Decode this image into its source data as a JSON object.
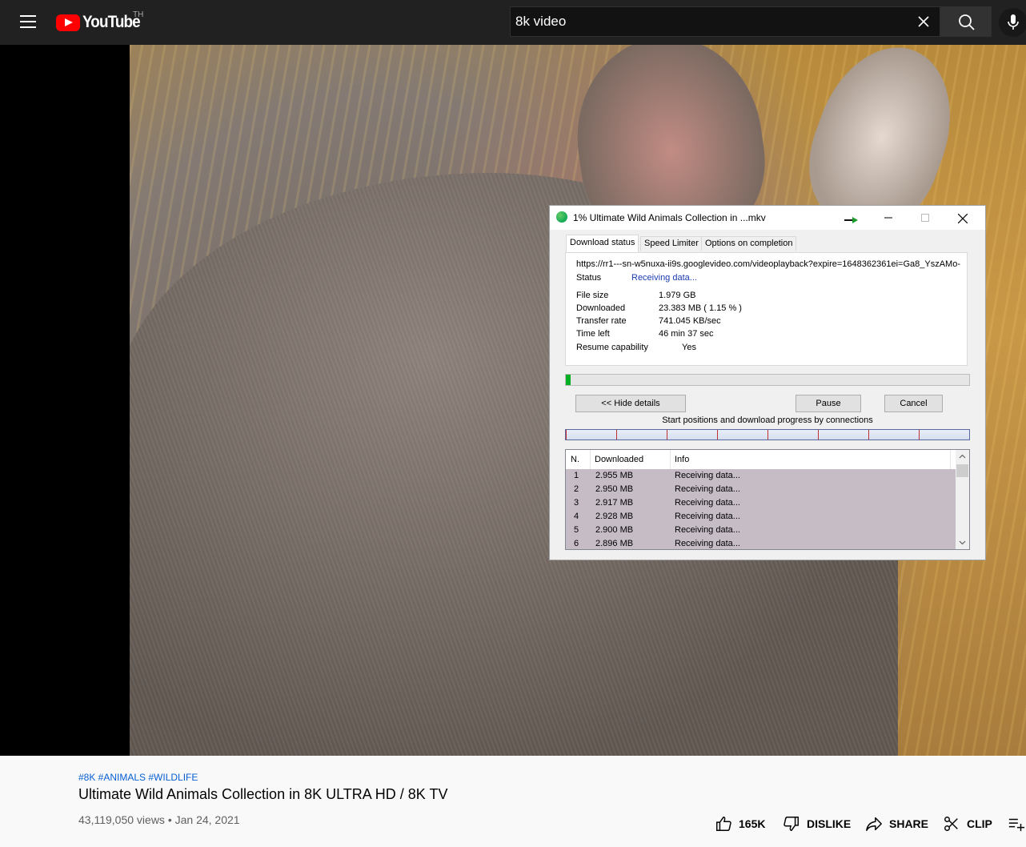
{
  "header": {
    "logo_text": "YouTube",
    "country_code": "TH",
    "search_value": "8k video"
  },
  "dialog": {
    "title": "1% Ultimate Wild Animals Collection in ...mkv",
    "tabs": [
      "Download status",
      "Speed Limiter",
      "Options on completion"
    ],
    "url": "https://rr1---sn-w5nuxa-ii9s.googlevideo.com/videoplayback?expire=1648362361ei=Ga8_YszAMo-",
    "status_label": "Status",
    "status_value": "Receiving data...",
    "file_size_label": "File size",
    "file_size_value": "1.979  GB",
    "downloaded_label": "Downloaded",
    "downloaded_value": "23.383  MB  ( 1.15 % )",
    "transfer_rate_label": "Transfer rate",
    "transfer_rate_value": "741.045  KB/sec",
    "time_left_label": "Time left",
    "time_left_value": "46 min 37 sec",
    "resume_label": "Resume capability",
    "resume_value": "Yes",
    "progress_fraction": 0.0115,
    "hide_details_label": "<< Hide details",
    "pause_label": "Pause",
    "cancel_label": "Cancel",
    "connections_label": "Start positions and download progress by connections",
    "table": {
      "headers": [
        "N.",
        "Downloaded",
        "Info"
      ],
      "rows": [
        {
          "n": "1",
          "downloaded": "2.955  MB",
          "info": "Receiving data..."
        },
        {
          "n": "2",
          "downloaded": "2.950  MB",
          "info": "Receiving data..."
        },
        {
          "n": "3",
          "downloaded": "2.917  MB",
          "info": "Receiving data..."
        },
        {
          "n": "4",
          "downloaded": "2.928  MB",
          "info": "Receiving data..."
        },
        {
          "n": "5",
          "downloaded": "2.900  MB",
          "info": "Receiving data..."
        },
        {
          "n": "6",
          "downloaded": "2.896  MB",
          "info": "Receiving data..."
        }
      ]
    }
  },
  "video": {
    "tags": "#8K #ANIMALS #WILDLIFE",
    "title": "Ultimate Wild Animals Collection in 8K ULTRA HD / 8K TV",
    "views_date": "43,119,050 views • Jan 24, 2021",
    "like_count": "165K",
    "dislike_label": "DISLIKE",
    "share_label": "SHARE",
    "clip_label": "CLIP"
  },
  "colors": {
    "brand_red": "#ff0000",
    "progress_green": "#06b025",
    "link_blue": "#065fd4"
  }
}
